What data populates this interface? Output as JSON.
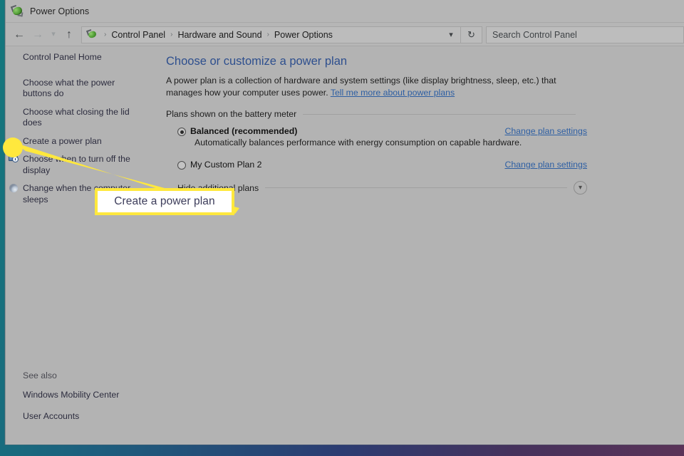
{
  "window": {
    "title": "Power Options",
    "icon": "power-plug-leaf-icon"
  },
  "nav": {
    "back_icon": "back-arrow-icon",
    "forward_icon": "forward-arrow-icon",
    "recent_icon": "chevron-down-icon",
    "up_icon": "up-arrow-icon",
    "crumb_icon": "power-plug-leaf-icon",
    "breadcrumbs": [
      "Control Panel",
      "Hardware and Sound",
      "Power Options"
    ],
    "separator": "›",
    "address_caret_icon": "chevron-down-icon",
    "refresh_icon": "refresh-icon",
    "search_placeholder": "Search Control Panel"
  },
  "sidebar": {
    "home_label": "Control Panel Home",
    "items": [
      {
        "label": "Choose what the power buttons do",
        "icon": null
      },
      {
        "label": "Choose what closing the lid does",
        "icon": null
      },
      {
        "label": "Create a power plan",
        "icon": null
      },
      {
        "label": "Choose when to turn off the display",
        "icon": "display-clock-icon"
      },
      {
        "label": "Change when the computer sleeps",
        "icon": "sleep-moon-icon"
      }
    ],
    "see_also": {
      "heading": "See also",
      "links": [
        "Windows Mobility Center",
        "User Accounts"
      ]
    }
  },
  "main": {
    "title": "Choose or customize a power plan",
    "description_part1": "A power plan is a collection of hardware and system settings (like display brightness, sleep, etc.) that manages how your computer uses power. ",
    "description_link": "Tell me more about power plans",
    "section_label": "Plans shown on the battery meter",
    "plans": [
      {
        "name": "Balanced (recommended)",
        "selected": true,
        "description": "Automatically balances performance with energy consumption on capable hardware.",
        "link": "Change plan settings"
      },
      {
        "name": "My Custom Plan 2",
        "selected": false,
        "description": "",
        "link": "Change plan settings"
      }
    ],
    "hide_plans_label": "Hide additional plans",
    "hide_plans_chevron_icon": "chevron-down-icon"
  },
  "annotation": {
    "callout_text": "Create a power plan",
    "highlight_color": "#ffe83d",
    "callout_bg": "#ffffff",
    "callout_text_color": "#3c3c5a"
  },
  "colors": {
    "window_bg": "#b3b3b3",
    "title_color": "#2e4f8e",
    "link_color": "#2e5fa3",
    "desktop_gradient_start": "#14787d",
    "desktop_gradient_end": "#5a3358"
  }
}
